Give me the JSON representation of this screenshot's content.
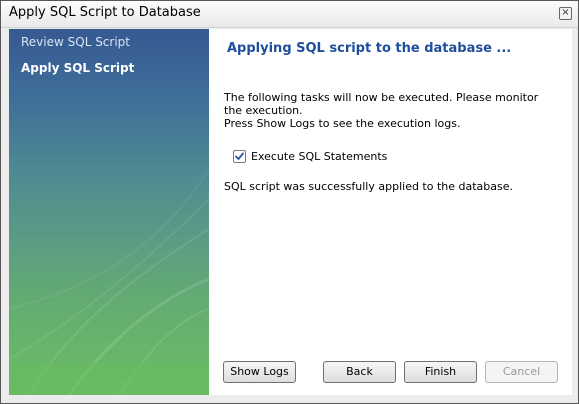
{
  "window": {
    "title": "Apply SQL Script to Database",
    "close_glyph": "×"
  },
  "sidebar": {
    "items": [
      {
        "label": "Review SQL Script",
        "state": "done"
      },
      {
        "label": "Apply SQL Script",
        "state": "current"
      }
    ]
  },
  "main": {
    "heading": "Applying SQL script to the database ...",
    "instructions_line1": "The following tasks will now be executed. Please monitor the execution.",
    "instructions_line2": "Press Show Logs to see the execution logs.",
    "task": {
      "label": "Execute SQL Statements",
      "checked": true
    },
    "status": "SQL script was successfully applied to the database."
  },
  "buttons": {
    "show_logs": "Show Logs",
    "back": "Back",
    "finish": "Finish",
    "cancel": "Cancel"
  },
  "colors": {
    "heading": "#1f4e9c",
    "sidebar_top": "#355a92",
    "sidebar_bottom": "#6cbc64"
  }
}
